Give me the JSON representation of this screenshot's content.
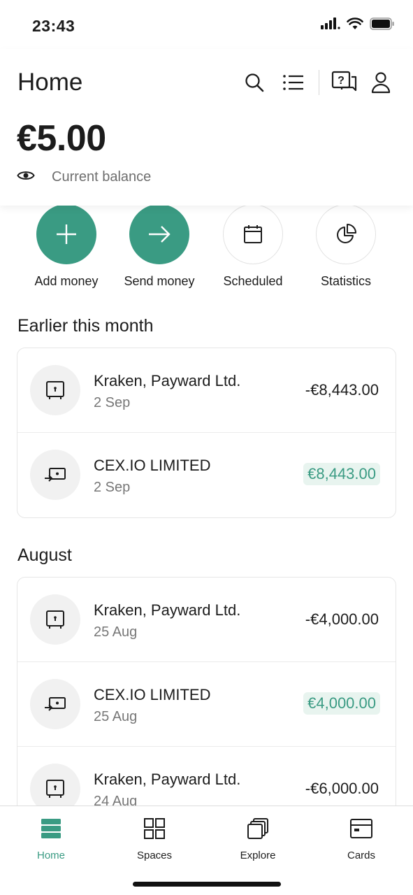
{
  "status": {
    "time": "23:43"
  },
  "header": {
    "title": "Home"
  },
  "balance": {
    "amount": "€5.00",
    "label": "Current balance"
  },
  "quick_actions": [
    {
      "label": "Add money",
      "icon": "plus-icon"
    },
    {
      "label": "Send money",
      "icon": "arrow-right-icon"
    },
    {
      "label": "Scheduled",
      "icon": "calendar-icon"
    },
    {
      "label": "Statistics",
      "icon": "pie-chart-icon"
    }
  ],
  "sections": [
    {
      "title": "Earlier this month",
      "transactions": [
        {
          "name": "Kraken, Payward Ltd.",
          "date": "2 Sep",
          "amount": "-€8,443.00",
          "icon": "safe-icon"
        },
        {
          "name": "CEX.IO LIMITED",
          "date": "2 Sep",
          "amount": "€8,443.00",
          "icon": "incoming-transfer-icon"
        }
      ]
    },
    {
      "title": "August",
      "transactions": [
        {
          "name": "Kraken, Payward Ltd.",
          "date": "25 Aug",
          "amount": "-€4,000.00",
          "icon": "safe-icon"
        },
        {
          "name": "CEX.IO LIMITED",
          "date": "25 Aug",
          "amount": "€4,000.00",
          "icon": "incoming-transfer-icon"
        },
        {
          "name": "Kraken, Payward Ltd.",
          "date": "24 Aug",
          "amount": "-€6,000.00",
          "icon": "safe-icon"
        }
      ]
    }
  ],
  "tabs": [
    {
      "label": "Home",
      "icon": "home-icon",
      "active": true
    },
    {
      "label": "Spaces",
      "icon": "grid-icon"
    },
    {
      "label": "Explore",
      "icon": "stack-icon"
    },
    {
      "label": "Cards",
      "icon": "card-icon"
    }
  ],
  "colors": {
    "accent": "#3a9b83",
    "positive_bg": "#e8f4ef",
    "text": "#1c1c1c",
    "muted": "#777777"
  }
}
